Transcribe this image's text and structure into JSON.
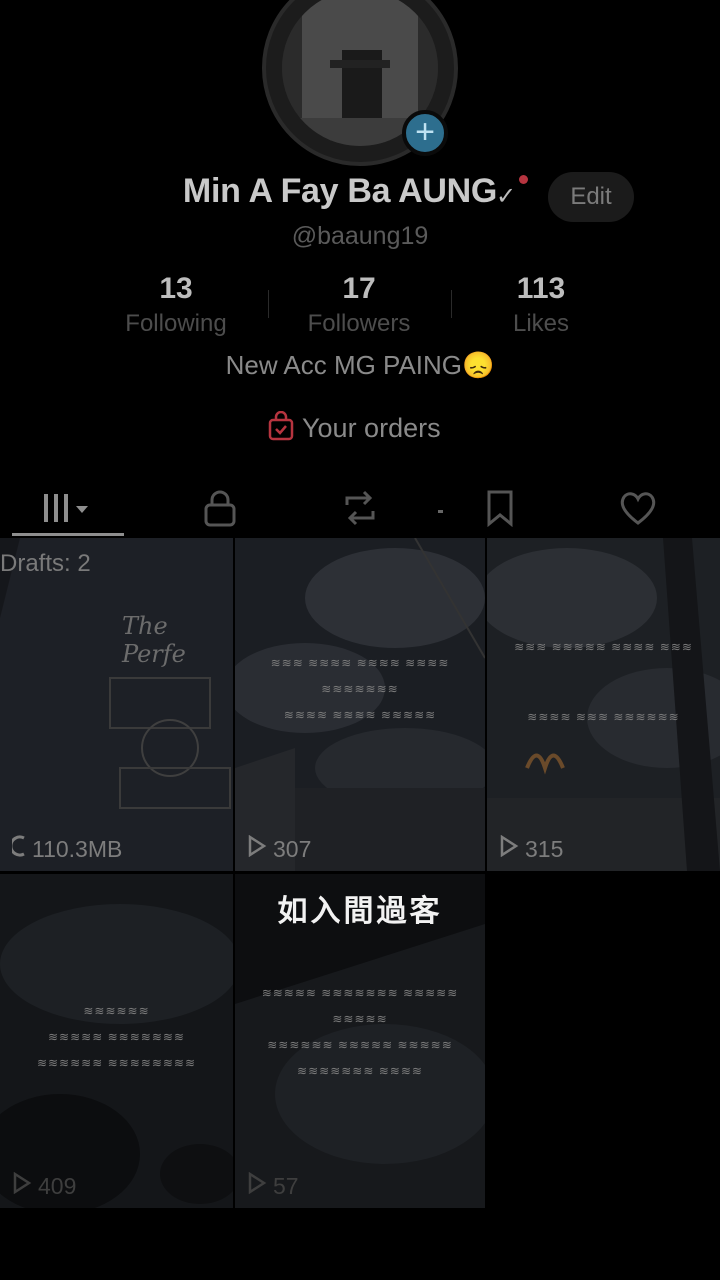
{
  "profile": {
    "display_name": "Min A Fay Ba AUNG",
    "username": "@baaung19",
    "edit_label": "Edit",
    "bio": "New Acc MG PAING😞"
  },
  "stats": [
    {
      "value": "13",
      "label": "Following"
    },
    {
      "value": "17",
      "label": "Followers"
    },
    {
      "value": "113",
      "label": "Likes"
    }
  ],
  "orders": {
    "label": "Your orders"
  },
  "tabs": [
    "videos-tab",
    "private-tab",
    "reposts-tab",
    "favorites-tab",
    "liked-tab"
  ],
  "grid": {
    "drafts_label": "Drafts: 2",
    "drafts_size": "110.3MB",
    "draft_shirt_text": "The Perfe",
    "items": [
      {
        "count": "307"
      },
      {
        "count": "315"
      },
      {
        "count": "409"
      },
      {
        "count": "57"
      }
    ]
  },
  "overlay_caption": "如入間過客",
  "colors": {
    "accent_red": "#b6343f",
    "add_badge": "#2d6e8e",
    "background": "#000000"
  }
}
